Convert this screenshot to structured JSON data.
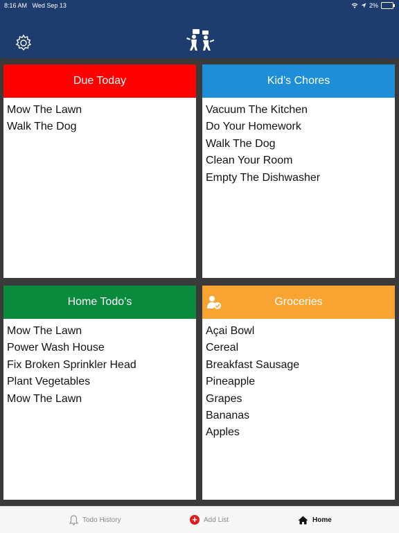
{
  "status_bar": {
    "time": "8:16 AM",
    "date": "Wed Sep 13",
    "battery_percent": "2%"
  },
  "header": {
    "settings_icon": "gear-icon",
    "logo_icon": "family-chores-logo-icon"
  },
  "cards": [
    {
      "title": "Due Today",
      "color": "#ff0000",
      "items": [
        "Mow The Lawn",
        "Walk The Dog"
      ]
    },
    {
      "title": "Kid’s Chores",
      "color": "#1e8fd6",
      "items": [
        "Vacuum The Kitchen",
        "Do Your Homework",
        "Walk The Dog",
        "Clean Your Room",
        "Empty The Dishwasher"
      ]
    },
    {
      "title": "Home Todo’s",
      "color": "#0a8a3c",
      "items": [
        "Mow The Lawn",
        "Power Wash House",
        "Fix Broken Sprinkler Head",
        "Plant Vegetables",
        "Mow The Lawn"
      ]
    },
    {
      "title": "Groceries",
      "color": "#f7a433",
      "header_icon": "user-check-icon",
      "items": [
        "Açai Bowl",
        "Cereal",
        "Breakfast Sausage",
        "Pineapple",
        "Grapes",
        "Bananas",
        "Apples"
      ]
    }
  ],
  "tabbar": {
    "todo_history": "Todo History",
    "add_list": "Add List",
    "home": "Home",
    "active_tab": "Home"
  }
}
